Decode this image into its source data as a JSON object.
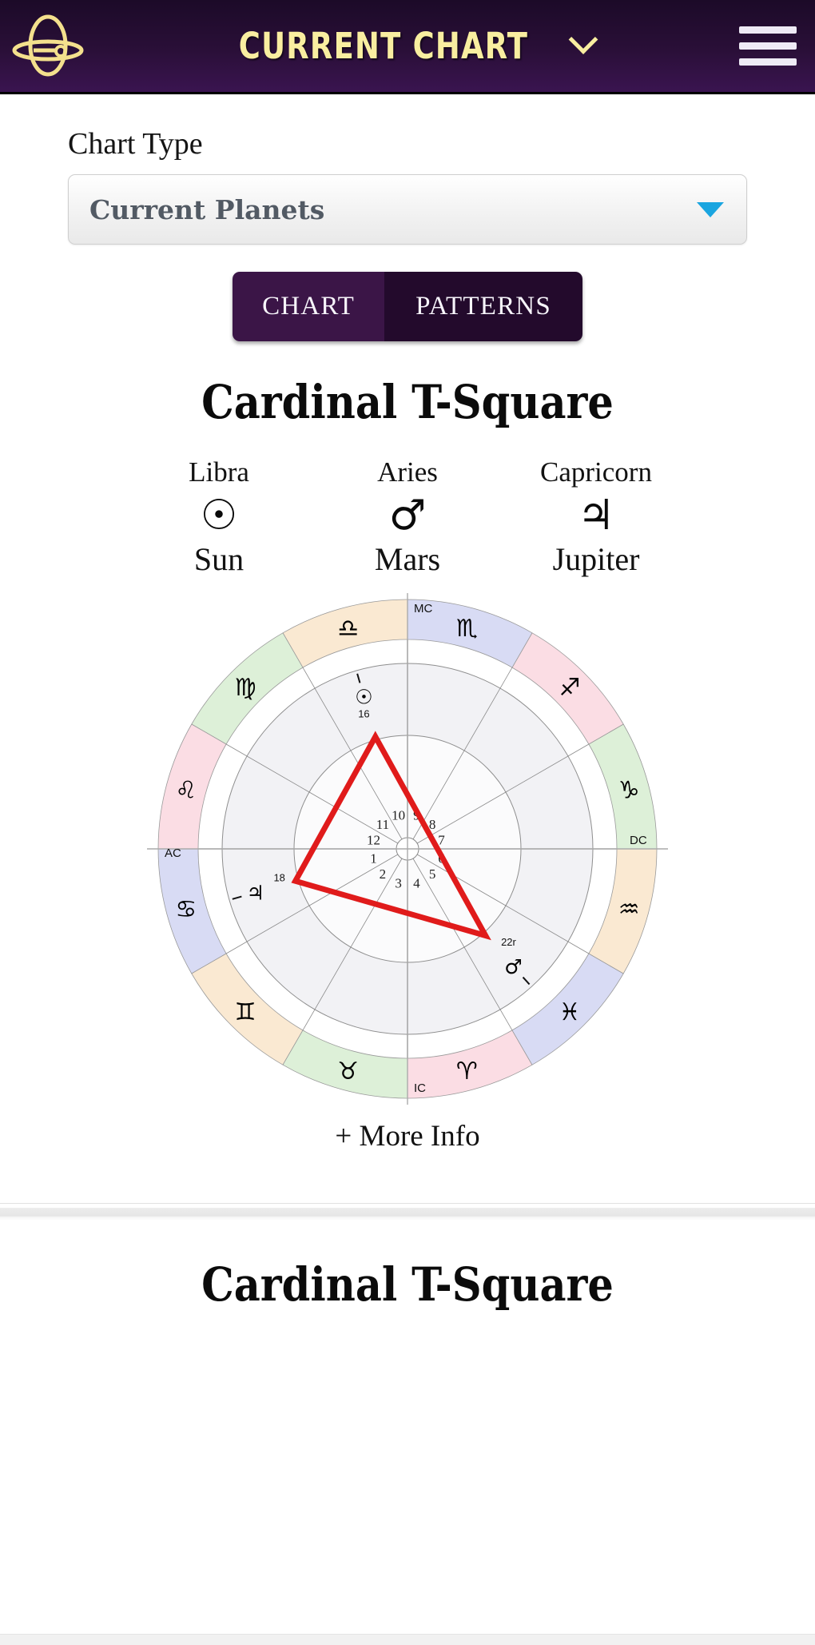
{
  "header": {
    "logo_icon": "saturn-planet-icon",
    "title": "CURRENT CHART",
    "dropdown_icon": "chevron-down-icon",
    "menu_icon": "hamburger-menu-icon"
  },
  "chart_type": {
    "label": "Chart Type",
    "selected": "Current Planets",
    "caret_icon": "caret-down-icon",
    "accent_color": "#1aa5e0"
  },
  "tabs": [
    {
      "label": "CHART",
      "active": true
    },
    {
      "label": "PATTERNS",
      "active": false
    }
  ],
  "pattern": {
    "title": "Cardinal T-Square",
    "planets": [
      {
        "sign": "Libra",
        "glyph": "☉",
        "name": "Sun"
      },
      {
        "sign": "Aries",
        "glyph": "♂",
        "name": "Mars"
      },
      {
        "sign": "Capricorn",
        "glyph": "♃",
        "name": "Jupiter"
      }
    ]
  },
  "more_info": {
    "label": "+ More Info"
  },
  "footer": {
    "title": "Cardinal T-Square"
  },
  "chart_data": {
    "type": "astrology-wheel",
    "title": "Cardinal T-Square",
    "aspect_pattern": "T-Square",
    "aspect_line_color": "#e01b1b",
    "angles": [
      {
        "name": "MC",
        "degree_on_wheel": 90
      },
      {
        "name": "AC",
        "degree_on_wheel": 180
      },
      {
        "name": "IC",
        "degree_on_wheel": 270
      },
      {
        "name": "DC",
        "degree_on_wheel": 0
      }
    ],
    "signs": [
      {
        "name": "Libra",
        "glyph": "♎",
        "element": "air",
        "color": "#fae9d2"
      },
      {
        "name": "Virgo",
        "glyph": "♍",
        "element": "earth",
        "color": "#ddf0d8"
      },
      {
        "name": "Leo",
        "glyph": "♌",
        "element": "fire",
        "color": "#fbdde4"
      },
      {
        "name": "Cancer",
        "glyph": "♋",
        "element": "water",
        "color": "#d8dbf4"
      },
      {
        "name": "Gemini",
        "glyph": "♊",
        "element": "air",
        "color": "#fae9d2"
      },
      {
        "name": "Taurus",
        "glyph": "♉",
        "element": "earth",
        "color": "#ddf0d8"
      },
      {
        "name": "Aries",
        "glyph": "♈",
        "element": "fire",
        "color": "#fbdde4"
      },
      {
        "name": "Pisces",
        "glyph": "♓",
        "element": "water",
        "color": "#d8dbf4"
      },
      {
        "name": "Aquarius",
        "glyph": "♒",
        "element": "air",
        "color": "#fae9d2"
      },
      {
        "name": "Capricorn",
        "glyph": "♑",
        "element": "earth",
        "color": "#ddf0d8"
      },
      {
        "name": "Sagittarius",
        "glyph": "♐",
        "element": "fire",
        "color": "#fbdde4"
      },
      {
        "name": "Scorpio",
        "glyph": "♏",
        "element": "water",
        "color": "#d8dbf4"
      }
    ],
    "houses": [
      1,
      2,
      3,
      4,
      5,
      6,
      7,
      8,
      9,
      10,
      11,
      12
    ],
    "planets": [
      {
        "name": "Sun",
        "glyph": "☉",
        "sign": "Libra",
        "degree": "16",
        "retrograde": false
      },
      {
        "name": "Jupiter",
        "glyph": "♃",
        "sign": "Capricorn",
        "degree": "18",
        "retrograde": false
      },
      {
        "name": "Mars",
        "glyph": "♂",
        "sign": "Aries",
        "degree": "22r",
        "retrograde": true
      }
    ]
  }
}
